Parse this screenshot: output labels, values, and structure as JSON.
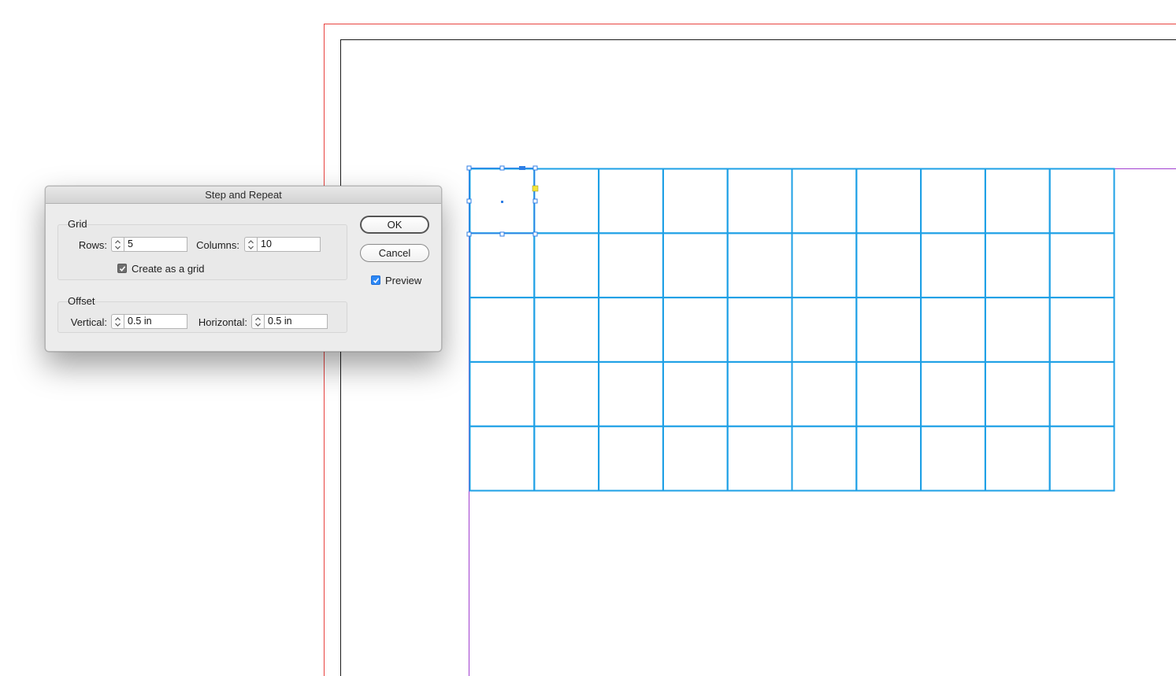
{
  "dialog": {
    "title": "Step and Repeat",
    "grid_group": {
      "title": "Grid",
      "rows_label": "Rows:",
      "rows_value": "5",
      "columns_label": "Columns:",
      "columns_value": "10",
      "create_as_grid_label": "Create as a grid",
      "create_as_grid_checked": true
    },
    "offset_group": {
      "title": "Offset",
      "vertical_label": "Vertical:",
      "vertical_value": "0.5 in",
      "horizontal_label": "Horizontal:",
      "horizontal_value": "0.5 in"
    },
    "ok_label": "OK",
    "cancel_label": "Cancel",
    "preview_label": "Preview",
    "preview_checked": true
  },
  "document_grid": {
    "rows": 5,
    "columns": 10
  },
  "colors": {
    "bleed_guide": "#e8423f",
    "margin_guide": "#a13fd0",
    "page_edge": "#000000",
    "frame_stroke": "#1ea0e6",
    "selection": "#2f7ee5",
    "dialog_bg": "#ececec"
  }
}
